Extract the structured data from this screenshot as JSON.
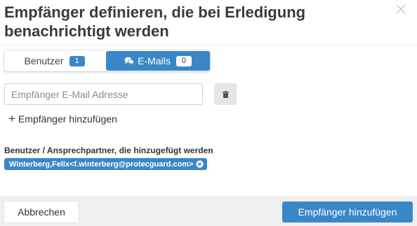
{
  "dialog": {
    "title": "Empfänger definieren, die bei Erledigung benachrichtigt werden",
    "close_icon": "close-icon"
  },
  "tabs": [
    {
      "label": "Benutzer",
      "count": "1",
      "active": false
    },
    {
      "label": "E-Mails",
      "count": "0",
      "active": true,
      "icon": "comments-icon"
    }
  ],
  "email_form": {
    "placeholder": "Empfänger E-Mail Adresse",
    "value": "",
    "delete_icon": "trash-icon",
    "add_label": "Empfänger hinzufügen"
  },
  "recipients": {
    "label": "Benutzer / Ansprechpartner, die hinzugefügt werden",
    "items": [
      {
        "text": "Winterberg,Felix<f.winterberg@protecguard.com>"
      }
    ]
  },
  "footer": {
    "cancel_label": "Abbrechen",
    "submit_label": "Empfänger hinzufügen"
  },
  "colors": {
    "accent": "#3a87c8",
    "footer_bg": "#efefef",
    "text": "#333333"
  }
}
